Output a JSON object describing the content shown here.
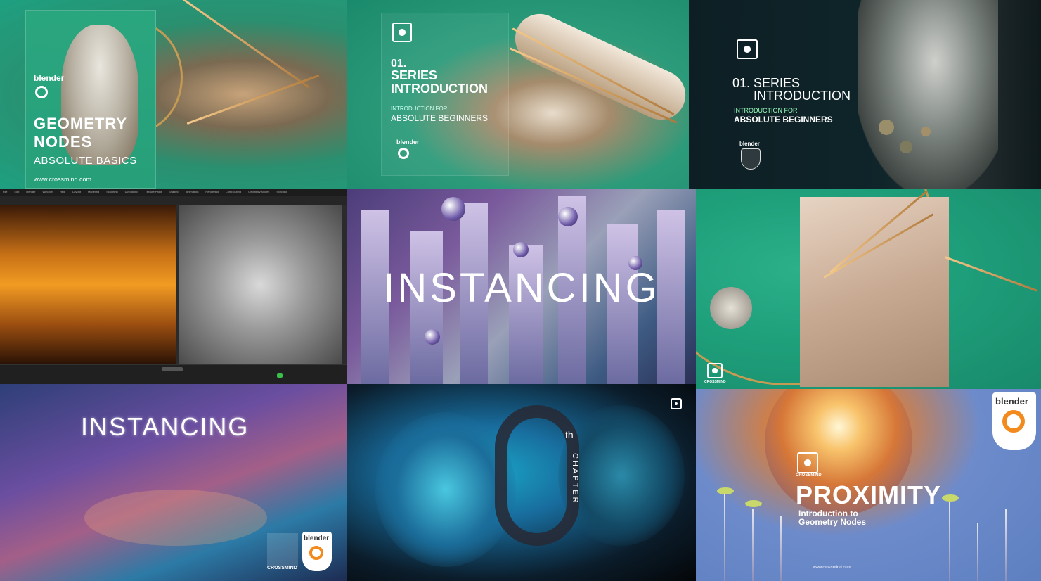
{
  "tiles": {
    "t1": {
      "brand": "blender",
      "title_line1": "GEOMETRY",
      "title_line2": "NODES",
      "subtitle": "ABSOLUTE BASICS",
      "url": "www.crossmind.com"
    },
    "t2": {
      "brand_small": "CROSSMIND",
      "number": "01.",
      "title_line1": "SERIES",
      "title_line2": "INTRODUCTION",
      "for_label": "INTRODUCTION FOR",
      "audience": "ABSOLUTE BEGINNERS",
      "blender": "blender"
    },
    "t3": {
      "brand_small": "CROSSMIND",
      "number_series": "01. SERIES",
      "title_line2": "INTRODUCTION",
      "for_label": "INTRODUCTION FOR",
      "audience": "ABSOLUTE BEGINNERS",
      "blender": "blender"
    },
    "t4": {
      "tabs": [
        "File",
        "Edit",
        "Render",
        "Window",
        "Help",
        "Layout",
        "Modeling",
        "Sculpting",
        "UV Editing",
        "Texture Paint",
        "Shading",
        "Animation",
        "Rendering",
        "Compositing",
        "Geometry Nodes",
        "Scripting"
      ]
    },
    "t5": {
      "title": "INSTANCING"
    },
    "t6": {
      "brand_small": "CROSSMIND"
    },
    "t7": {
      "title": "INSTANCING",
      "brand_small": "CROSSMIND",
      "blender": "blender"
    },
    "t8": {
      "suffix": "th",
      "chapter": "CHAPTER"
    },
    "t9": {
      "blender": "blender",
      "brand_small": "CROSSMIND",
      "title": "PROXIMITY",
      "sub_line1": "Introduction to",
      "sub_line2": "Geometry Nodes",
      "url": "www.crossmind.com"
    }
  },
  "colors": {
    "green_bg": "#1ea080",
    "dark_teal": "#0d1f24",
    "blender_orange": "#f28a1d",
    "white": "#ffffff"
  },
  "icons": [
    "crossmind-logo-icon",
    "blender-logo-icon"
  ]
}
